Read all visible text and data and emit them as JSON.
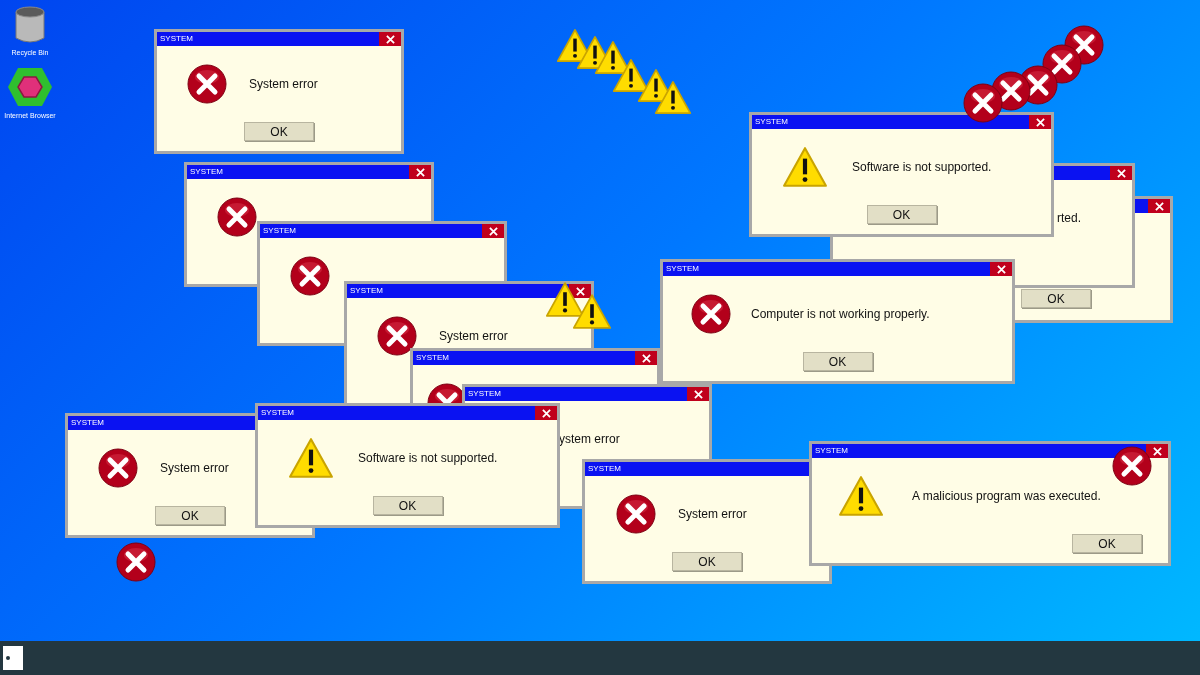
{
  "desktop_icons": [
    {
      "label": "Recycle Bin",
      "kind": "trash"
    },
    {
      "label": "Internet Browser",
      "kind": "browser"
    }
  ],
  "windows": [
    {
      "title": "SYSTEM",
      "kind": "error",
      "message": "System error",
      "button": "OK"
    },
    {
      "title": "SYSTEM",
      "kind": "error"
    },
    {
      "title": "SYSTEM",
      "kind": "error"
    },
    {
      "title": "SYSTEM",
      "kind": "error",
      "message": "System error"
    },
    {
      "title": "SYSTEM",
      "kind": "error"
    },
    {
      "title": "SYSTEM",
      "kind": "plain",
      "message": "ystem error"
    },
    {
      "title": "SYSTEM",
      "kind": "error",
      "message": "System error",
      "button": "OK"
    },
    {
      "title": "SYSTEM",
      "kind": "warning",
      "message": "Software is not supported.",
      "button": "OK"
    },
    {
      "kind": "plain",
      "button": "OK"
    },
    {
      "kind": "plain",
      "message": "rted."
    },
    {
      "title": "SYSTEM",
      "kind": "warning",
      "message": "Software is not supported.",
      "button": "OK"
    },
    {
      "title": "SYSTEM",
      "kind": "error",
      "message": "Computer is not working properly.",
      "button": "OK"
    },
    {
      "title": "SYSTEM",
      "kind": "error",
      "message": "System error",
      "button": "OK"
    },
    {
      "title": "SYSTEM",
      "kind": "warning",
      "message": "A malicious program was executed.",
      "button": "OK"
    }
  ]
}
